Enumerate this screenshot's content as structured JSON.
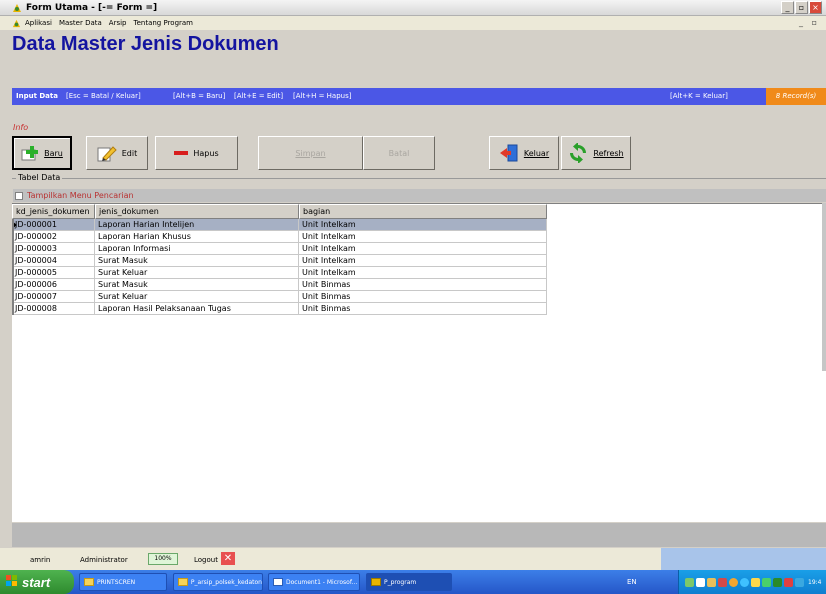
{
  "window": {
    "title": "Form Utama - [-= Form =]",
    "minimize_icon": "minimize-icon",
    "restore_icon": "restore-icon",
    "close_icon": "close-icon"
  },
  "menu": {
    "items": [
      "Aplikasi",
      "Master Data",
      "Arsip",
      "Tentang Program"
    ]
  },
  "header": {
    "page_title": "Data Master Jenis Dokumen"
  },
  "shortcuts": {
    "label": "Input Data",
    "esc": "[Esc = Batal / Keluar]",
    "baru": "[Alt+B = Baru]",
    "edit": "[Alt+E = Edit]",
    "hapus": "[Alt+H = Hapus]",
    "keluar": "[Alt+K = Keluar]",
    "records": "8 Record(s)"
  },
  "info_label": "Info",
  "toolbar": {
    "baru": "Baru",
    "edit": "Edit",
    "hapus": "Hapus",
    "simpan": "Simpan",
    "batal": "Batal",
    "keluar": "Keluar",
    "refresh": "Refresh"
  },
  "table_section": {
    "label": "Tabel Data",
    "search_toggle": "Tampilkan Menu Pencarian"
  },
  "grid": {
    "columns": [
      "kd_jenis_dokumen",
      "jenis_dokumen",
      "bagian"
    ],
    "rows": [
      [
        "JD-000001",
        "Laporan Harian Intelijen",
        "Unit Intelkam"
      ],
      [
        "JD-000002",
        "Laporan Harian Khusus",
        "Unit Intelkam"
      ],
      [
        "JD-000003",
        "Laporan Informasi",
        "Unit Intelkam"
      ],
      [
        "JD-000004",
        "Surat Masuk",
        "Unit Intelkam"
      ],
      [
        "JD-000005",
        "Surat Keluar",
        "Unit Intelkam"
      ],
      [
        "JD-000006",
        "Surat Masuk",
        "Unit Binmas"
      ],
      [
        "JD-000007",
        "Surat Keluar",
        "Unit Binmas"
      ],
      [
        "JD-000008",
        "Laporan Hasil Pelaksanaan Tugas",
        "Unit Binmas"
      ]
    ],
    "selected_row": 0
  },
  "status": {
    "user": "amrin",
    "role": "Administrator",
    "zoom": "100%",
    "logout": "Logout"
  },
  "taskbar": {
    "start": "start",
    "items": [
      "PRINTSCREN",
      "P_arsip_polsek_kedaton",
      "Document1 - Microsof...",
      "P_program"
    ],
    "lang": "EN",
    "clock": "19:4"
  },
  "colors": {
    "title_blue": "#1414a0",
    "shortcut_bar": "#4b57e6",
    "records_badge": "#f08a1a",
    "selected_row": "#a6b0c4"
  }
}
